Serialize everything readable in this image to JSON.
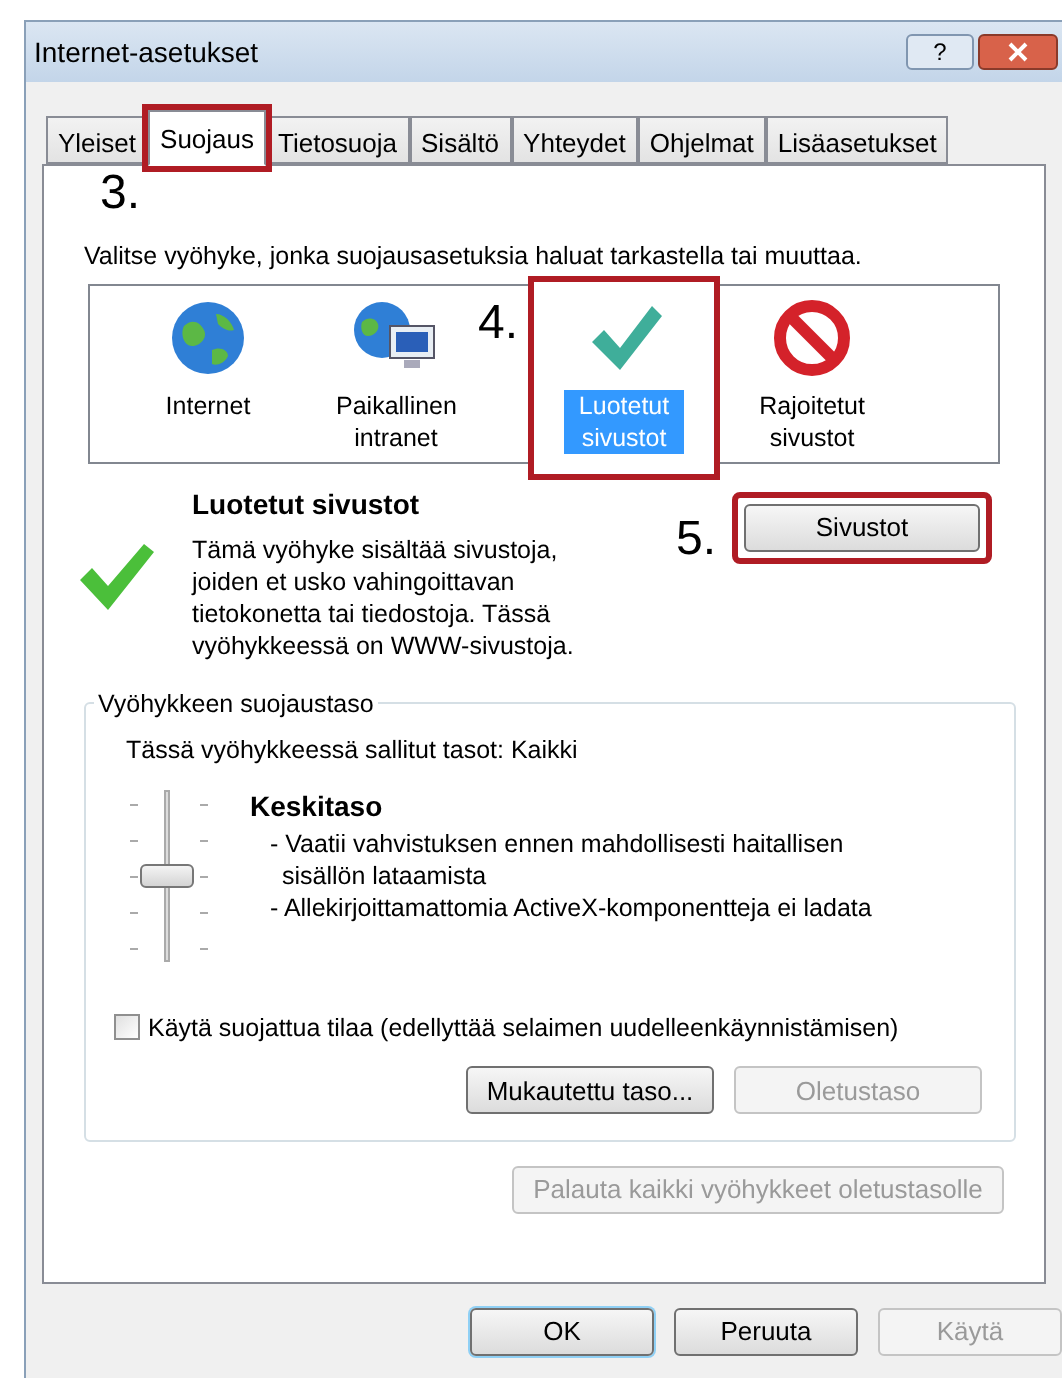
{
  "window": {
    "title": "Internet-asetukset",
    "help": "?"
  },
  "tabs": [
    {
      "label": "Yleiset",
      "selected": false,
      "highlighted": false
    },
    {
      "label": "Suojaus",
      "selected": true,
      "highlighted": true
    },
    {
      "label": "Tietosuoja",
      "selected": false,
      "highlighted": false
    },
    {
      "label": "Sisältö",
      "selected": false,
      "highlighted": false
    },
    {
      "label": "Yhteydet",
      "selected": false,
      "highlighted": false
    },
    {
      "label": "Ohjelmat",
      "selected": false,
      "highlighted": false
    },
    {
      "label": "Lisäasetukset",
      "selected": false,
      "highlighted": false
    }
  ],
  "step_labels": [
    "3.",
    "4.",
    "5."
  ],
  "instruction": "Valitse vyöhyke, jonka suojausasetuksia haluat tarkastella tai muuttaa.",
  "zones": [
    {
      "kind": "globe",
      "label": "Internet",
      "selected": false,
      "highlighted": false
    },
    {
      "kind": "network",
      "label": "Paikallinen intranet",
      "selected": false,
      "highlighted": false
    },
    {
      "kind": "check",
      "label": "Luotetut sivustot",
      "selected": true,
      "highlighted": true
    },
    {
      "kind": "blocked",
      "label": "Rajoitetut sivustot",
      "selected": false,
      "highlighted": false
    }
  ],
  "zone_info": {
    "title": "Luotetut sivustot",
    "description": "Tämä vyöhyke sisältää sivustoja, joiden et usko vahingoittavan tietokonetta tai tiedostoja. Tässä vyöhykkeessä on WWW-sivustoja.",
    "sites_button": {
      "label": "Sivustot",
      "highlighted": true
    }
  },
  "security_level": {
    "legend": "Vyöhykkeen suojaustaso",
    "allowed": "Tässä vyöhykkeessä sallitut tasot: Kaikki",
    "level": 0.5,
    "name": "Keskitaso",
    "points": [
      "- Vaatii vahvistuksen ennen mahdollisesti haitallisen sisällön lataamista",
      "- Allekirjoittamattomia ActiveX-komponentteja ei ladata"
    ],
    "protected_mode": {
      "label": "Käytä suojattua tilaa (edellyttää selaimen uudelleenkäynnistämisen)",
      "checked": false
    },
    "buttons": [
      {
        "label": "Mukautettu taso...",
        "disabled": false
      },
      {
        "label": "Oletustaso",
        "disabled": true
      }
    ]
  },
  "reset_all": {
    "label": "Palauta kaikki vyöhykkeet oletustasolle",
    "disabled": true
  },
  "footer_buttons": [
    {
      "label": "OK",
      "disabled": false,
      "default": true
    },
    {
      "label": "Peruuta",
      "disabled": false,
      "default": false
    },
    {
      "label": "Käytä",
      "disabled": true,
      "default": false
    }
  ]
}
